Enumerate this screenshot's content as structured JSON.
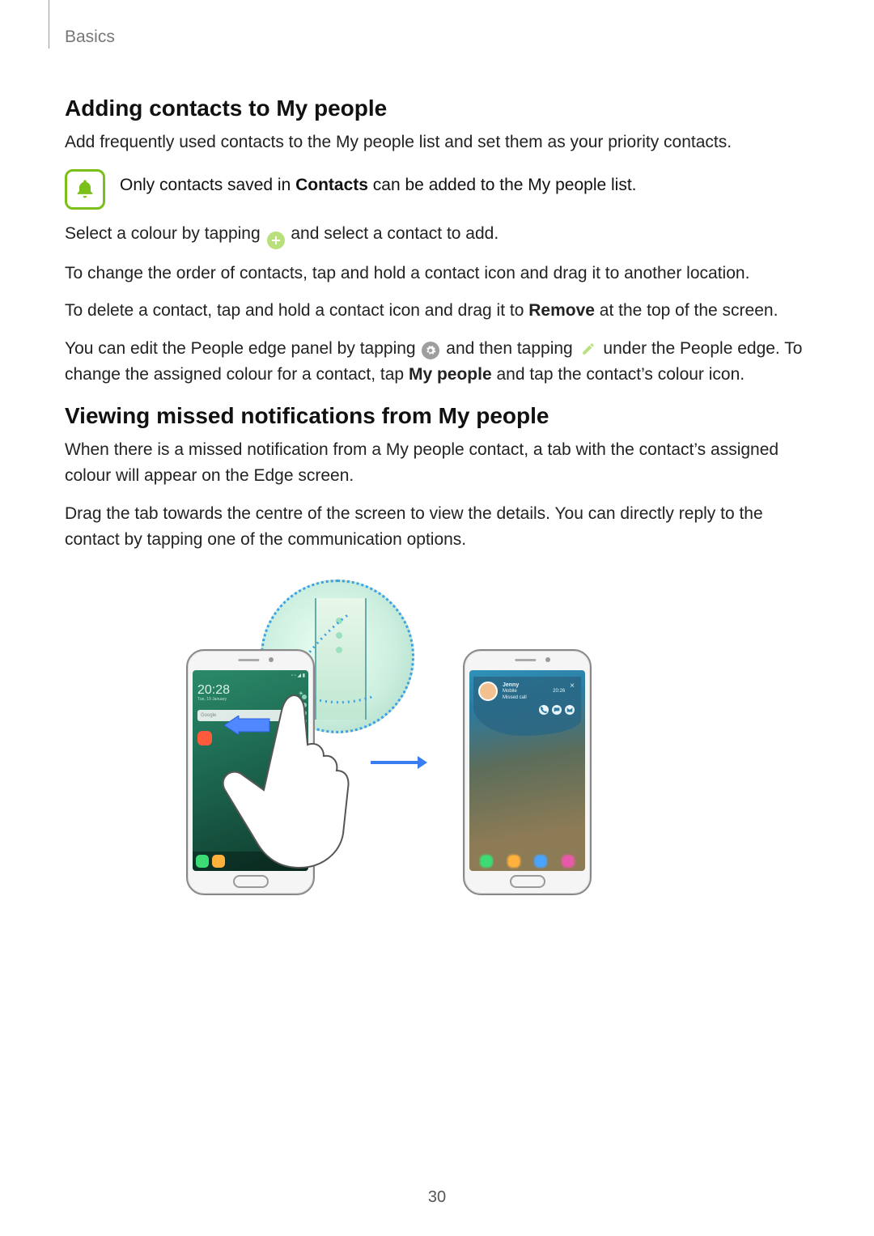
{
  "header": {
    "section": "Basics"
  },
  "s1": {
    "heading": "Adding contacts to My people",
    "intro": "Add frequently used contacts to the My people list and set them as your priority contacts.",
    "callout_a": "Only contacts saved in ",
    "callout_bold": "Contacts",
    "callout_b": " can be added to the My people list.",
    "p2a": "Select a colour by tapping ",
    "p2b": " and select a contact to add.",
    "p3": "To change the order of contacts, tap and hold a contact icon and drag it to another location.",
    "p4a": "To delete a contact, tap and hold a contact icon and drag it to ",
    "p4bold": "Remove",
    "p4b": " at the top of the screen.",
    "p5a": "You can edit the People edge panel by tapping ",
    "p5b": " and then tapping ",
    "p5c": " under the People edge. To change the assigned colour for a contact, tap ",
    "p5bold": "My people",
    "p5d": " and tap the contact’s colour icon."
  },
  "s2": {
    "heading": "Viewing missed notifications from My people",
    "p1": "When there is a missed notification from a My people contact, a tab with the contact’s assigned colour will appear on the Edge screen.",
    "p2": "Drag the tab towards the centre of the screen to view the details. You can directly reply to the contact by tapping one of the communication options."
  },
  "figure": {
    "left_phone": {
      "clock": "20:28",
      "date": "Tue, 19 January",
      "search_label": "Google",
      "app_colors": [
        "#ff5a3c"
      ],
      "dock_colors": [
        "#3cdc74",
        "#ffb13c"
      ]
    },
    "right_phone": {
      "contact_name": "Jenny",
      "meta_line1": "Mobile",
      "meta_line2": "Missed call",
      "meta_time": "20:26",
      "blurred": [
        "#3cdc74",
        "#ffb13c",
        "#4aa3ff",
        "#e85aa8"
      ]
    }
  },
  "page_number": "30"
}
